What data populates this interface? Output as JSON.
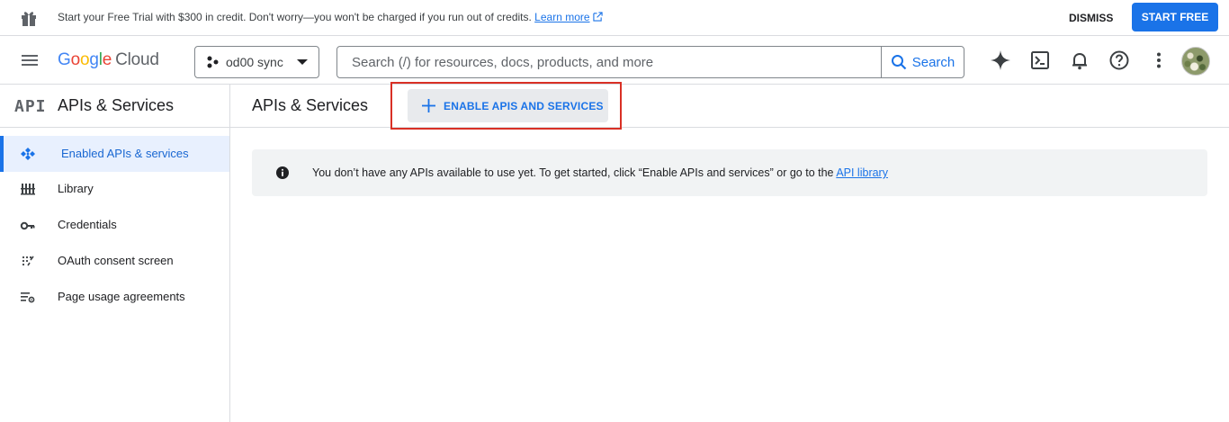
{
  "promo": {
    "message": "Start your Free Trial with $300 in credit. Don't worry—you won't be charged if you run out of credits.",
    "learn_more": "Learn more",
    "dismiss": "DISMISS",
    "start_free": "START FREE"
  },
  "header": {
    "logo_google": [
      "G",
      "o",
      "o",
      "g",
      "l",
      "e"
    ],
    "logo_cloud": "Cloud",
    "project": "od00 sync",
    "search_placeholder": "Search (/) for resources, docs, products, and more",
    "search_button": "Search"
  },
  "sidebar": {
    "logo": "API",
    "title": "APIs & Services",
    "items": [
      {
        "label": "Enabled APIs & services",
        "icon": "enabled-apis-icon",
        "active": true
      },
      {
        "label": "Library",
        "icon": "library-icon"
      },
      {
        "label": "Credentials",
        "icon": "key-icon"
      },
      {
        "label": "OAuth consent screen",
        "icon": "oauth-icon"
      },
      {
        "label": "Page usage agreements",
        "icon": "settings-list-icon"
      }
    ]
  },
  "main": {
    "title": "APIs & Services",
    "enable_button": "ENABLE APIS AND SERVICES",
    "info_text": "You don’t have any APIs available to use yet. To get started, click “Enable APIs and services” or go to the",
    "info_link": "API library"
  },
  "colors": {
    "accent": "#1a73e8",
    "highlight": "#d93025",
    "active_bg": "#e8f0fe"
  }
}
